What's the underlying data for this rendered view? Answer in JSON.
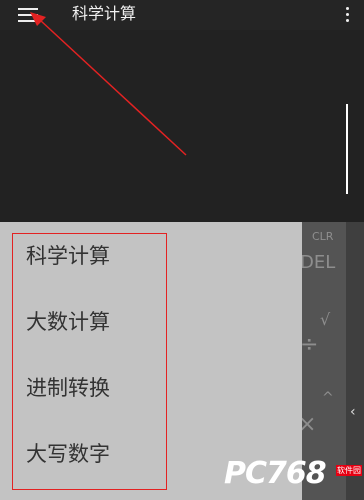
{
  "app_bar": {
    "title": "科学计算",
    "menu_icon": "hamburger-menu-icon",
    "more_icon": "more-vert-icon"
  },
  "keypad": {
    "clr": "CLR",
    "del": "DEL",
    "sqrt": "√",
    "divide": "÷",
    "power": "^",
    "multiply": "×",
    "side_chevron": "‹"
  },
  "drawer": {
    "items": [
      {
        "label": "科学计算"
      },
      {
        "label": "大数计算"
      },
      {
        "label": "进制转换"
      },
      {
        "label": "大写数字"
      }
    ]
  },
  "watermark": {
    "text": "PC768",
    "sub": "软件园"
  },
  "colors": {
    "annotation_red": "#e32222",
    "toolbar_bg": "#252525",
    "drawer_bg": "#c3c3c3",
    "keypad_bg": "#545454"
  }
}
